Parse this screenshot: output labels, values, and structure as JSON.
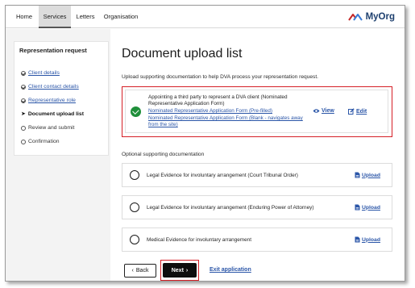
{
  "nav": {
    "tabs": [
      {
        "label": "Home",
        "active": false
      },
      {
        "label": "Services",
        "active": true
      },
      {
        "label": "Letters",
        "active": false
      },
      {
        "label": "Organisation",
        "active": false
      }
    ],
    "brand": "MyOrg"
  },
  "sidebar": {
    "title": "Representation request",
    "items": [
      {
        "label": "Client details",
        "state": "complete"
      },
      {
        "label": "Client contact details",
        "state": "complete"
      },
      {
        "label": "Representative role",
        "state": "complete"
      },
      {
        "label": "Document upload list",
        "state": "current"
      },
      {
        "label": "Review and submit",
        "state": "todo"
      },
      {
        "label": "Confirmation",
        "state": "todo"
      }
    ]
  },
  "main": {
    "title": "Document upload list",
    "intro": "Upload supporting documentation to help DVA process your representation request.",
    "required": {
      "title": "Appointing a third party to represent a DVA client (Nominated Representative Application Form)",
      "link1": "Nominated Representative Application Form (Pre-filled)",
      "link2": "Nominated Representative Application Form (Blank - navigates away from the site)",
      "view_label": "View",
      "edit_label": "Edit"
    },
    "optional_heading": "Optional supporting documentation",
    "optional": [
      {
        "label": "Legal Evidence for involuntary arrangement (Court Tribunal Order)",
        "action": "Upload"
      },
      {
        "label": "Legal Evidence for involuntary arrangement (Enduring Power of Attorney)",
        "action": "Upload"
      },
      {
        "label": "Medical Evidence for involuntary arrangement",
        "action": "Upload"
      }
    ],
    "buttons": {
      "back": "Back",
      "next": "Next",
      "exit": "Exit application"
    }
  },
  "colors": {
    "accent_red": "#d51f26",
    "success_green": "#1f8f3a",
    "link_blue": "#2b56a8"
  }
}
